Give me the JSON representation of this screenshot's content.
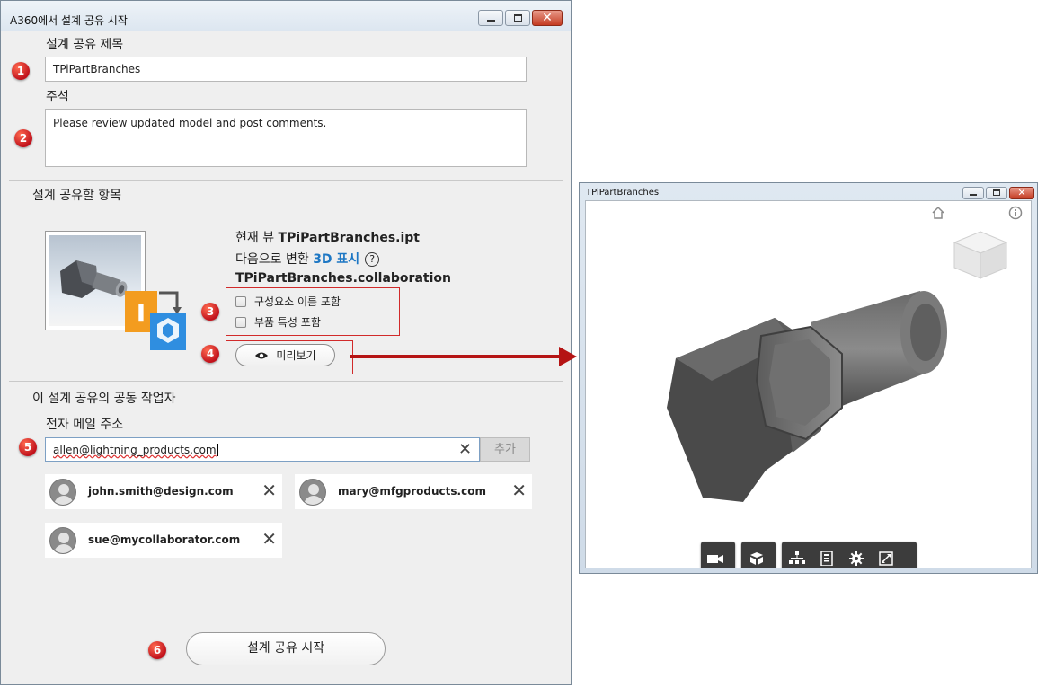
{
  "dialog": {
    "title": "A360에서 설계 공유 시작",
    "share_title_label": "설계 공유 제목",
    "share_title_value": "TPiPartBranches",
    "notes_label": "주석",
    "notes_value": "Please review updated model and post comments.",
    "items_label": "설계 공유할 항목",
    "current_view_prefix": "현재 뷰 ",
    "current_view_file": "TPiPartBranches.ipt",
    "convert_prefix": "다음으로 변환 ",
    "convert_target": "3D 표시",
    "help_glyph": "?",
    "collab_file": "TPiPartBranches.collaboration",
    "checkbox_component_names": "구성요소 이름 포함",
    "checkbox_part_properties": "부품 특성 포함",
    "preview_button": "미리보기",
    "collaborators_label": "이 설계 공유의 공동 작업자",
    "email_label": "전자 메일 주소",
    "email_value": "allen@lightning_products.com",
    "add_button": "추가",
    "collaborators": [
      "john.smith@design.com",
      "mary@mfgproducts.com",
      "sue@mycollaborator.com"
    ],
    "start_button": "설계 공유 시작"
  },
  "badges": [
    "1",
    "2",
    "3",
    "4",
    "5",
    "6"
  ],
  "preview": {
    "title": "TPiPartBranches",
    "toolbar_icons": [
      "camera-icon",
      "cube-icon",
      "tree-icon",
      "properties-icon",
      "gear-icon",
      "fullscreen-icon"
    ]
  },
  "colors": {
    "accent_blue": "#1d77c4",
    "badge_red": "#c1121c",
    "highlight_red": "#d12a2a",
    "toolbar_dark": "#3c3c3c"
  }
}
